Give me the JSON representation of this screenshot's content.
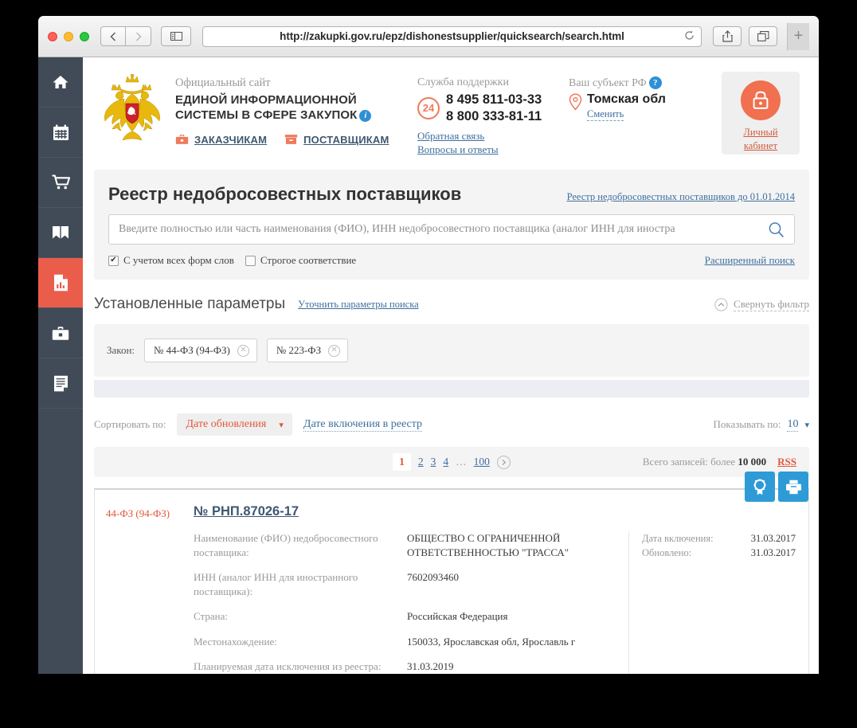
{
  "browser": {
    "url": "http://zakupki.gov.ru/epz/dishonestsupplier/quicksearch/search.html",
    "back_icon": "chevron-left-icon",
    "forward_icon": "chevron-right-icon",
    "sidebar_icon": "sidebar-toggle-icon",
    "reload_icon": "reload-icon",
    "share_icon": "share-icon",
    "tabs_icon": "tabs-icon",
    "new_tab_label": "+"
  },
  "rail": {
    "items": [
      {
        "icon": "home-icon",
        "active": false
      },
      {
        "icon": "calendar-icon",
        "active": false
      },
      {
        "icon": "cart-icon",
        "active": false
      },
      {
        "icon": "book-icon",
        "active": false
      },
      {
        "icon": "document-chart-icon",
        "active": true
      },
      {
        "icon": "briefcase-icon",
        "active": false
      },
      {
        "icon": "list-document-icon",
        "active": false
      }
    ]
  },
  "header": {
    "emblem_icon": "russian-coat-of-arms",
    "kicker": "Официальный сайт",
    "title_line1": "ЕДИНОЙ ИНФОРМАЦИОННОЙ",
    "title_line2": "СИСТЕМЫ В СФЕРЕ ЗАКУПОК",
    "info_badge": "i",
    "links": [
      {
        "label": "ЗАКАЗЧИКАМ",
        "icon": "briefcase-icon"
      },
      {
        "label": "ПОСТАВЩИКАМ",
        "icon": "box-icon"
      }
    ],
    "support": {
      "kicker": "Служба поддержки",
      "badge": "24",
      "phone1": "8 495 811-03-33",
      "phone2": "8 800 333-81-11",
      "link1": "Обратная связь",
      "link2": "Вопросы и ответы"
    },
    "region": {
      "kicker": "Ваш субъект РФ",
      "help_badge": "?",
      "pin_icon": "map-pin-icon",
      "name": "Томская обл",
      "change_label": "Сменить"
    },
    "cabinet": {
      "icon": "lock-icon",
      "label_line1": "Личный",
      "label_line2": "кабинет"
    }
  },
  "search": {
    "title": "Реестр недобросовестных поставщиков",
    "archive_link": "Реестр недобросовестных поставщиков до 01.01.2014",
    "placeholder": "Введите полностью или часть наименования (ФИО), ИНН недобросовестного поставщика (аналог ИНН для иностра",
    "value": "",
    "search_icon": "search-icon",
    "checkbox1": {
      "label": "С учетом всех форм слов",
      "checked": true,
      "mark": "✔"
    },
    "checkbox2": {
      "label": "Строгое соответствие",
      "checked": false,
      "mark": ""
    },
    "advanced_link": "Расширенный поиск"
  },
  "params": {
    "title": "Установленные параметры",
    "refine_link": "Уточнить параметры поиска",
    "collapse_label": "Свернуть фильтр",
    "collapse_icon": "chevron-up-circle-icon",
    "filter_label": "Закон:",
    "chips": [
      {
        "label": "№ 44-ФЗ (94-ФЗ)",
        "remove": "✕"
      },
      {
        "label": "№ 223-ФЗ",
        "remove": "✕"
      }
    ]
  },
  "sort": {
    "label": "Сортировать по:",
    "selected": "Дате обновления",
    "caret": "▾",
    "alt_link": "Дате включения в реестр",
    "per_page_label": "Показывать по:",
    "per_page_value": "10",
    "per_page_caret": "▾"
  },
  "pagination": {
    "pages": [
      "1",
      "2",
      "3",
      "4",
      "…",
      "100"
    ],
    "current": "1",
    "next_icon": "chevron-right-circle-icon",
    "total_label": "Всего записей: более",
    "total_value": "10 000",
    "rss_label": "RSS"
  },
  "result": {
    "law": "44-ФЗ (94-ФЗ)",
    "number": "№ РНП.87026-17",
    "actions": [
      {
        "icon": "award-seal-icon"
      },
      {
        "icon": "printer-icon"
      }
    ],
    "fields": [
      {
        "label": "Наименование (ФИО) недобросовестного поставщика:",
        "value": "ОБЩЕСТВО С ОГРАНИЧЕННОЙ ОТВЕТСТВЕННОСТЬЮ \"ТРАССА\""
      },
      {
        "label": "ИНН (аналог ИНН для иностранного поставщика):",
        "value": "7602093460"
      },
      {
        "label": "Страна:",
        "value": "Российская Федерация"
      },
      {
        "label": "Местонахождение:",
        "value": "150033, Ярославская обл, Ярославль г"
      },
      {
        "label": "Планируемая дата исключения из реестра:",
        "value": "31.03.2019"
      }
    ],
    "dates": [
      {
        "label": "Дата включения:",
        "value": "31.03.2017"
      },
      {
        "label": "Обновлено:",
        "value": "31.03.2017"
      }
    ]
  },
  "colors": {
    "accent_orange": "#e2573a",
    "rail_dark": "#414b57",
    "rail_active": "#eb5d4b",
    "link_blue": "#3e6f9e",
    "action_blue": "#2e9bd6"
  }
}
